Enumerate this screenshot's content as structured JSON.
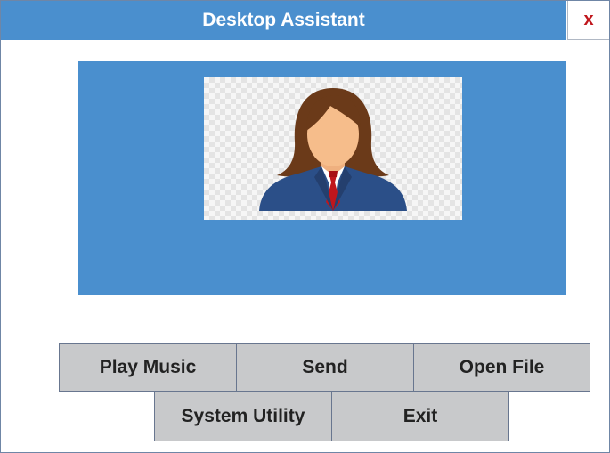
{
  "window": {
    "title": "Desktop Assistant",
    "close_label": "x"
  },
  "display": {
    "avatar_icon": "female-assistant-avatar-icon"
  },
  "buttons": {
    "play_music": "Play Music",
    "send": "Send",
    "open_file": "Open File",
    "system_utility": "System Utility",
    "exit": "Exit"
  },
  "colors": {
    "accent": "#4a8fce",
    "button_bg": "#c8c9cb",
    "close_icon": "#c0161c"
  }
}
